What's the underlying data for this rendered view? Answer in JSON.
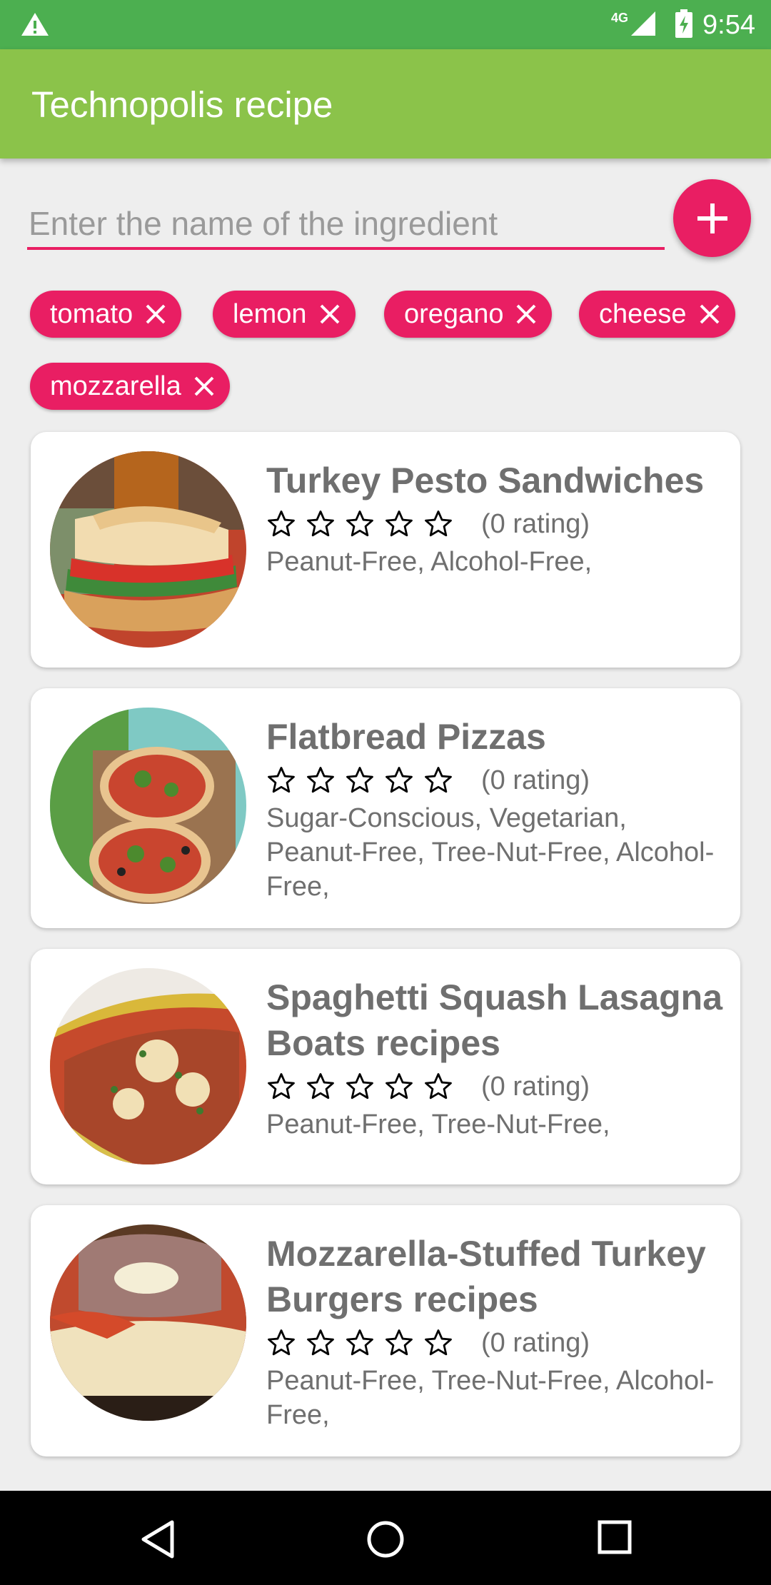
{
  "status_bar": {
    "network": "4G",
    "time": "9:54",
    "icons": [
      "warning-icon",
      "signal-icon",
      "battery-charging-icon"
    ]
  },
  "app_bar": {
    "title": "Technopolis recipe"
  },
  "search": {
    "placeholder": "Enter the name of the ingredient",
    "value": "",
    "add_icon": "plus-icon"
  },
  "chips": [
    {
      "label": "tomato"
    },
    {
      "label": "lemon"
    },
    {
      "label": "oregano"
    },
    {
      "label": "cheese"
    },
    {
      "label": "mozzarella"
    }
  ],
  "recipes": [
    {
      "title": "Turkey Pesto Sandwiches",
      "rating_text": "(0 rating)",
      "rating": 0,
      "labels": "Peanut-Free, Alcohol-Free,"
    },
    {
      "title": "Flatbread Pizzas",
      "rating_text": "(0 rating)",
      "rating": 0,
      "labels": "Sugar-Conscious, Vegetarian, Peanut-Free, Tree-Nut-Free, Alcohol-Free,"
    },
    {
      "title": "Spaghetti Squash Lasagna Boats recipes",
      "rating_text": "(0 rating)",
      "rating": 0,
      "labels": "Peanut-Free, Tree-Nut-Free,"
    },
    {
      "title": "Mozzarella-Stuffed Turkey Burgers recipes",
      "rating_text": "(0 rating)",
      "rating": 0,
      "labels": "Peanut-Free, Tree-Nut-Free, Alcohol-Free,"
    }
  ],
  "nav_bar": {
    "icons": [
      "back-icon",
      "home-icon",
      "recents-icon"
    ]
  },
  "colors": {
    "status_bar": "#4caf50",
    "app_bar": "#8bc34a",
    "accent": "#e91e63",
    "background": "#eeeeee"
  }
}
